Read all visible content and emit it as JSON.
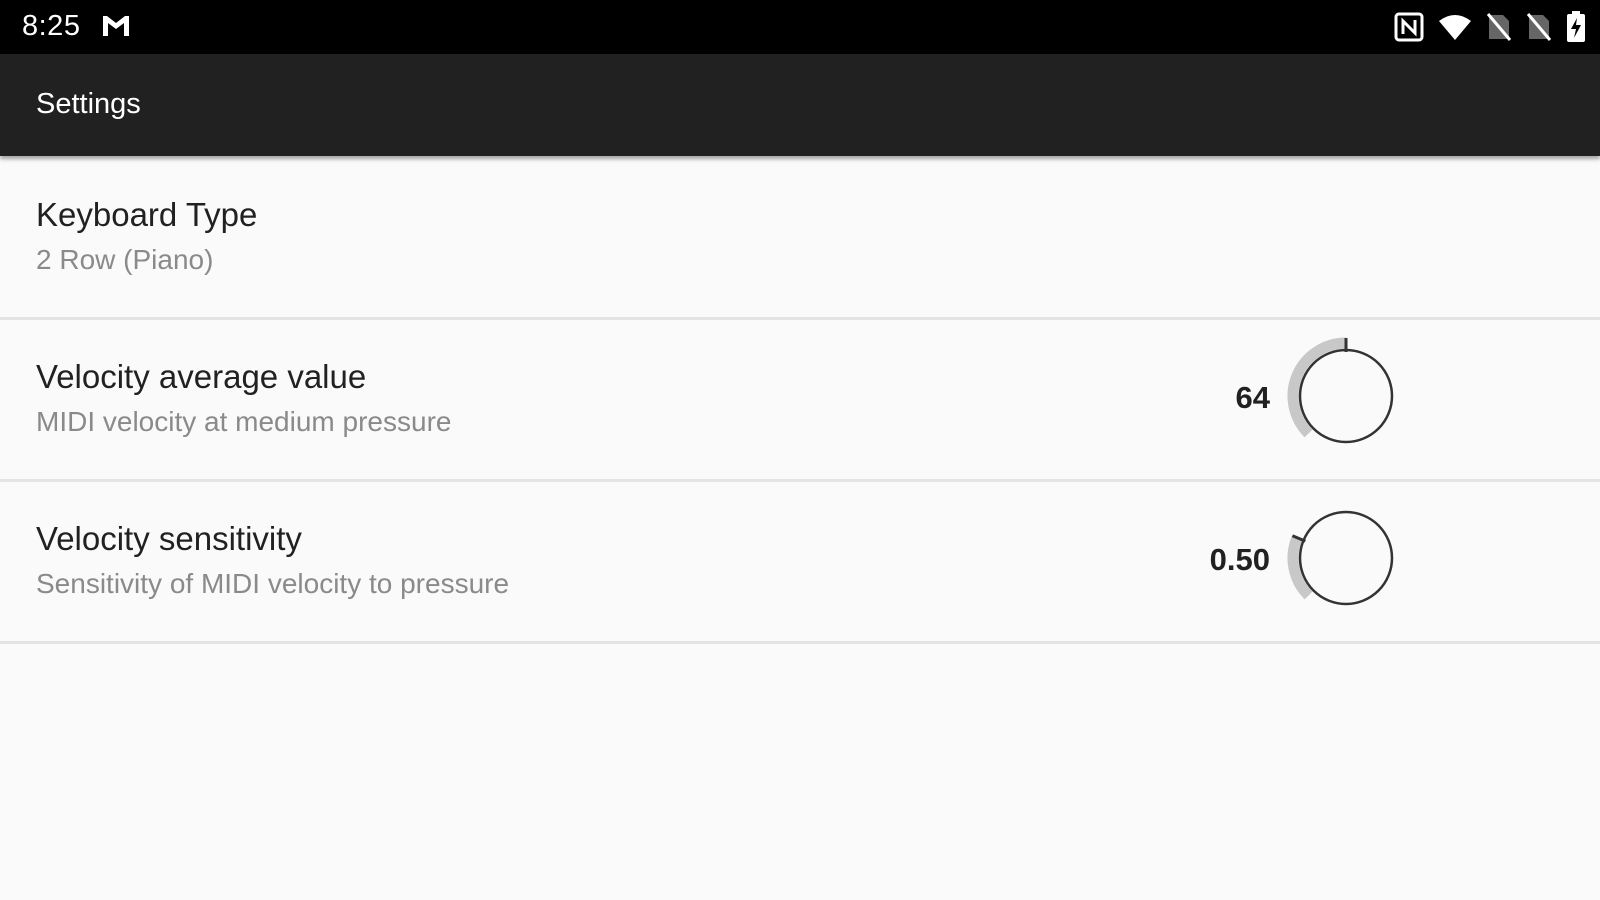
{
  "status_bar": {
    "time": "8:25",
    "left_icon": "gmail-icon",
    "right_icons": [
      "nfc-icon",
      "wifi-icon",
      "no-sim-icon",
      "no-sim-icon",
      "battery-charging-icon"
    ]
  },
  "app_bar": {
    "title": "Settings"
  },
  "settings": [
    {
      "title": "Keyboard Type",
      "summary": "2 Row (Piano)"
    },
    {
      "title": "Velocity average value",
      "summary": "MIDI velocity at medium pressure",
      "value": "64",
      "knob_fraction": 0.5
    },
    {
      "title": "Velocity sensitivity",
      "summary": "Sensitivity of MIDI velocity to pressure",
      "value": "0.50",
      "knob_fraction": 0.25
    }
  ],
  "colors": {
    "status_bar": "#000000",
    "app_bar": "#212121",
    "background": "#fafafa",
    "knob_track": "#c8c8c8",
    "knob_outline": "#333333"
  }
}
